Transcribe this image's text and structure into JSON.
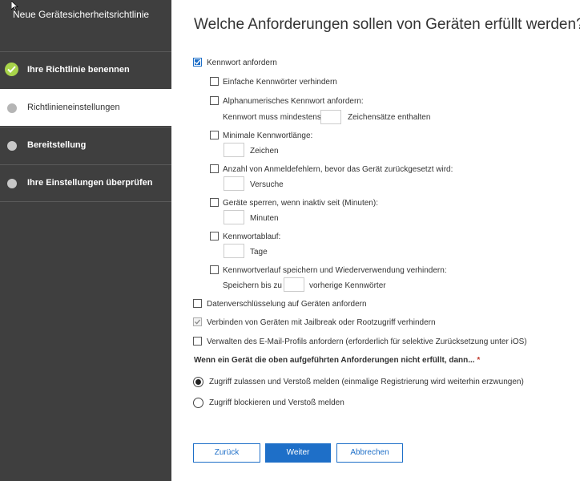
{
  "sidebar": {
    "title": "Neue Gerätesicherheitsrichtlinie",
    "steps": [
      {
        "label": "Ihre Richtlinie benennen",
        "state": "done"
      },
      {
        "label": "Richtlinieneinstellungen",
        "state": "active"
      },
      {
        "label": "Bereitstellung",
        "state": "pending"
      },
      {
        "label": "Ihre Einstellungen überprüfen",
        "state": "pending"
      }
    ]
  },
  "main": {
    "heading": "Welche Anforderungen sollen von Geräten erfüllt werden?",
    "require_password": {
      "label": "Kennwort anfordern",
      "checked": true
    },
    "options": {
      "simple": {
        "label": "Einfache Kennwörter verhindern",
        "checked": false
      },
      "alnum": {
        "label": "Alphanumerisches Kennwort anfordern:",
        "checked": false,
        "sub_prefix": "Kennwort muss mindestens",
        "sub_suffix": "Zeichensätze enthalten",
        "value": ""
      },
      "minlen": {
        "label": "Minimale Kennwortlänge:",
        "checked": false,
        "unit": "Zeichen",
        "value": ""
      },
      "failures": {
        "label": "Anzahl von Anmeldefehlern, bevor das Gerät zurückgesetzt wird:",
        "checked": false,
        "unit": "Versuche",
        "value": ""
      },
      "lock": {
        "label": "Geräte sperren, wenn inaktiv seit (Minuten):",
        "checked": false,
        "unit": "Minuten",
        "value": ""
      },
      "expiry": {
        "label": "Kennwortablauf:",
        "checked": false,
        "unit": "Tage",
        "value": ""
      },
      "history": {
        "label": "Kennwortverlauf speichern und Wiederverwendung verhindern:",
        "checked": false,
        "sub_prefix": "Speichern bis zu",
        "sub_suffix": "vorherige Kennwörter",
        "value": ""
      }
    },
    "encryption": {
      "label": "Datenverschlüsselung auf Geräten anfordern",
      "checked": false
    },
    "jailbreak": {
      "label": "Verbinden von Geräten mit Jailbreak oder Rootzugriff verhindern",
      "checked": true,
      "disabled": true
    },
    "email_profile": {
      "label": "Verwalten des E-Mail-Profils anfordern (erforderlich für selektive Zurücksetzung unter iOS)",
      "checked": false
    },
    "question": "Wenn ein Gerät die oben aufgeführten Anforderungen nicht erfüllt, dann...",
    "required_mark": "*",
    "radios": [
      {
        "label": "Zugriff zulassen und Verstoß melden (einmalige Registrierung wird weiterhin erzwungen)",
        "selected": true
      },
      {
        "label": "Zugriff blockieren und Verstoß melden",
        "selected": false
      }
    ],
    "buttons": {
      "back": "Zurück",
      "next": "Weiter",
      "cancel": "Abbrechen"
    }
  }
}
